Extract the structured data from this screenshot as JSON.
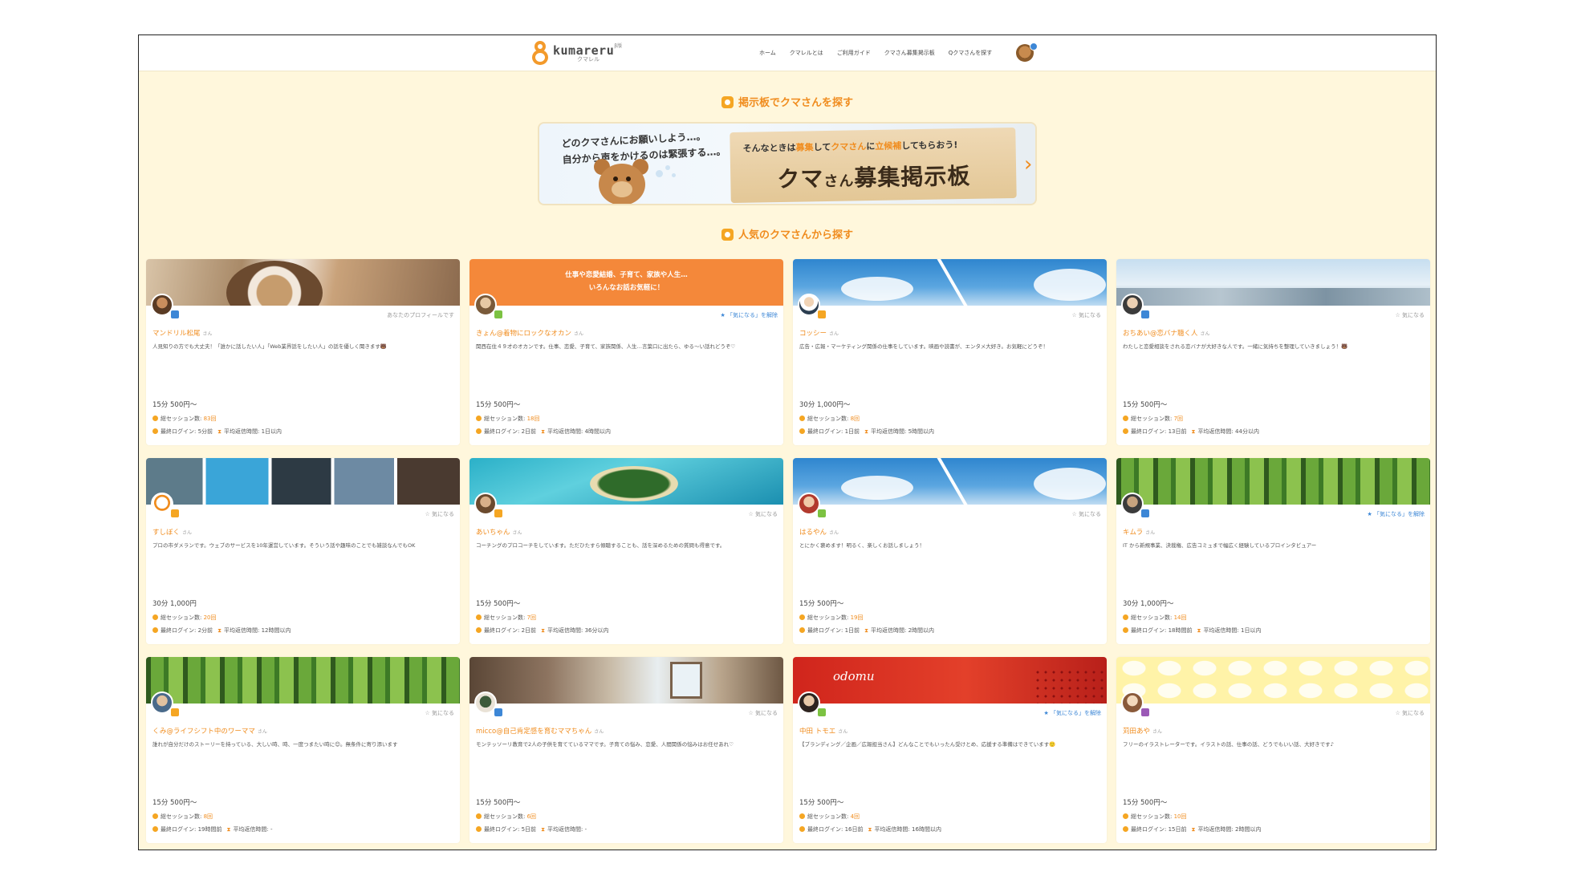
{
  "nav": {
    "logo_text": "kumareru",
    "logo_beta": "β版",
    "logo_sub": "クマレル",
    "menu": [
      "ホーム",
      "クマレルとは",
      "ご利用ガイド",
      "クマさん募集掲示板",
      "Qクマさんを探す"
    ]
  },
  "section1": {
    "title": "掲示板でクマさんを探す"
  },
  "banner": {
    "question_line1": "どのクマさんにお願いしよう…。",
    "question_line2": "自分から声をかけるのは緊張する…。",
    "tagline_a": "そんなときは",
    "tagline_b": "募集",
    "tagline_c": "して",
    "tagline_d": "クマさん",
    "tagline_e": "に",
    "tagline_f": "立候補",
    "tagline_g": "してもらおう!",
    "big_a": "クマ",
    "big_b": "さん",
    "big_c": "募集掲示板"
  },
  "section2": {
    "title": "人気のクマさんから探す"
  },
  "colors": {
    "accent": "#f08c1e",
    "badge_blue": "#3d87d6",
    "badge_orange": "#f5a623",
    "badge_green": "#7cc242",
    "badge_purple": "#9b59b6",
    "background": "#fff7dc"
  },
  "cards": [
    {
      "name": "マンドリル松尾",
      "suffix": "さん",
      "fav": "あなたのプロフィールです",
      "desc": "人見知りの方でも大丈夫！「誰かに話したい人」「Web業界話をしたい人」の話を優しく聞きます🐻",
      "price": "15分 500円〜",
      "sessions_label": "総セッション数:",
      "sessions": "83回",
      "login_label": "最終ログイン:",
      "login": "5分前",
      "reply_label": "平均返信時間:",
      "reply": "1日以内"
    },
    {
      "name": "きょん@着物にロックなオカン",
      "suffix": "さん",
      "fav": "「気になる」を解除",
      "cover_text1": "仕事や恋愛結婚、子育て、家族や人生…",
      "cover_text2": "いろんなお話お気軽に！",
      "desc": "関西在住４９才のオカンです。仕事、恋愛、子育て、家族関係、人生…言葉口に出たら、ゆる〜い話れどうぞ♡",
      "price": "15分 500円〜",
      "sessions_label": "総セッション数:",
      "sessions": "18回",
      "login_label": "最終ログイン:",
      "login": "2日前",
      "reply_label": "平均返信時間:",
      "reply": "4時間以内"
    },
    {
      "name": "コッシー",
      "suffix": "さん",
      "fav": "気になる",
      "desc": "広告・広報・マーケティング関係の仕事をしています。映画や読書が、エンタメ大好き。お気軽にどうぞ！",
      "price": "30分 1,000円〜",
      "sessions_label": "総セッション数:",
      "sessions": "8回",
      "login_label": "最終ログイン:",
      "login": "1日前",
      "reply_label": "平均返信時間:",
      "reply": "5時間以内"
    },
    {
      "name": "おちあい@恋バナ聴く人",
      "suffix": "さん",
      "fav": "気になる",
      "desc": "わたしと恋愛相談をされる恋バナが大好きな人です。一緒に気持ちを整理していきましょう！🐻",
      "price": "15分 500円〜",
      "sessions_label": "総セッション数:",
      "sessions": "7回",
      "login_label": "最終ログイン:",
      "login": "13日前",
      "reply_label": "平均返信時間:",
      "reply": "44分以内"
    },
    {
      "name": "すしぼく",
      "suffix": "さん",
      "fav": "気になる",
      "desc": "プロの市ダメランです。ウェブのサービスを10年運営しています。そういう話や趣味のことでも雑談なんでもOK",
      "price": "30分 1,000円",
      "sessions_label": "総セッション数:",
      "sessions": "20回",
      "login_label": "最終ログイン:",
      "login": "2分前",
      "reply_label": "平均返信時間:",
      "reply": "12時間以内"
    },
    {
      "name": "あいちゃん",
      "suffix": "さん",
      "fav": "気になる",
      "desc": "コーチングのプロコーチをしています。ただひたすら傾聴することも、話を深めるための質問も得意です。",
      "price": "15分 500円〜",
      "sessions_label": "総セッション数:",
      "sessions": "7回",
      "login_label": "最終ログイン:",
      "login": "2日前",
      "reply_label": "平均返信時間:",
      "reply": "36分以内"
    },
    {
      "name": "はるやん",
      "suffix": "さん",
      "fav": "気になる",
      "desc": "とにかく褒めます！明るく、楽しくお話しましょう！",
      "price": "15分 500円〜",
      "sessions_label": "総セッション数:",
      "sessions": "19回",
      "login_label": "最終ログイン:",
      "login": "1日前",
      "reply_label": "平均返信時間:",
      "reply": "2時間以内"
    },
    {
      "name": "キムラ",
      "suffix": "さん",
      "fav": "「気になる」を解除",
      "desc": "IT から新規事業、決裁権、広告コミュまで幅広く経験しているプロインタビュアー",
      "price": "30分 1,000円〜",
      "sessions_label": "総セッション数:",
      "sessions": "14回",
      "login_label": "最終ログイン:",
      "login": "18時間前",
      "reply_label": "平均返信時間:",
      "reply": "1日以内"
    },
    {
      "name": "くみ@ライフシフト中のワーママ",
      "suffix": "さん",
      "fav": "気になる",
      "desc": "誰れが自分だけのストーリーを持っている、大しい時、時、一度つまたい時に😊。無条件に寄り添います",
      "price": "15分 500円〜",
      "sessions_label": "総セッション数:",
      "sessions": "8回",
      "login_label": "最終ログイン:",
      "login": "19時間前",
      "reply_label": "平均返信時間:",
      "reply": "-"
    },
    {
      "name": "micco@自己肯定感を育むママちゃん",
      "suffix": "さん",
      "fav": "気になる",
      "desc": "モンテッソーリ教育で2人の子供を育てているママです。子育ての悩み、恋愛、人間関係の悩みはお任せあれ♡",
      "price": "15分 500円〜",
      "sessions_label": "総セッション数:",
      "sessions": "6回",
      "login_label": "最終ログイン:",
      "login": "5日前",
      "reply_label": "平均返信時間:",
      "reply": "-"
    },
    {
      "name": "中田 トモエ",
      "suffix": "さん",
      "fav": "「気になる」を解除",
      "cover_script": "odomu",
      "desc": "【ブランディング／企画／広報担当さん】どんなことでもいったん受けとめ、応援する準備はできています🙂",
      "price": "15分 500円〜",
      "sessions_label": "総セッション数:",
      "sessions": "4回",
      "login_label": "最終ログイン:",
      "login": "16日前",
      "reply_label": "平均返信時間:",
      "reply": "16時間以内"
    },
    {
      "name": "苅田あや",
      "suffix": "さん",
      "fav": "気になる",
      "desc": "フリーのイラストレーターです。イラストの話、仕事の話、どうでもいい話、大好きです♪",
      "price": "15分 500円〜",
      "sessions_label": "総セッション数:",
      "sessions": "10回",
      "login_label": "最終ログイン:",
      "login": "15日前",
      "reply_label": "平均返信時間:",
      "reply": "2時間以内"
    }
  ]
}
